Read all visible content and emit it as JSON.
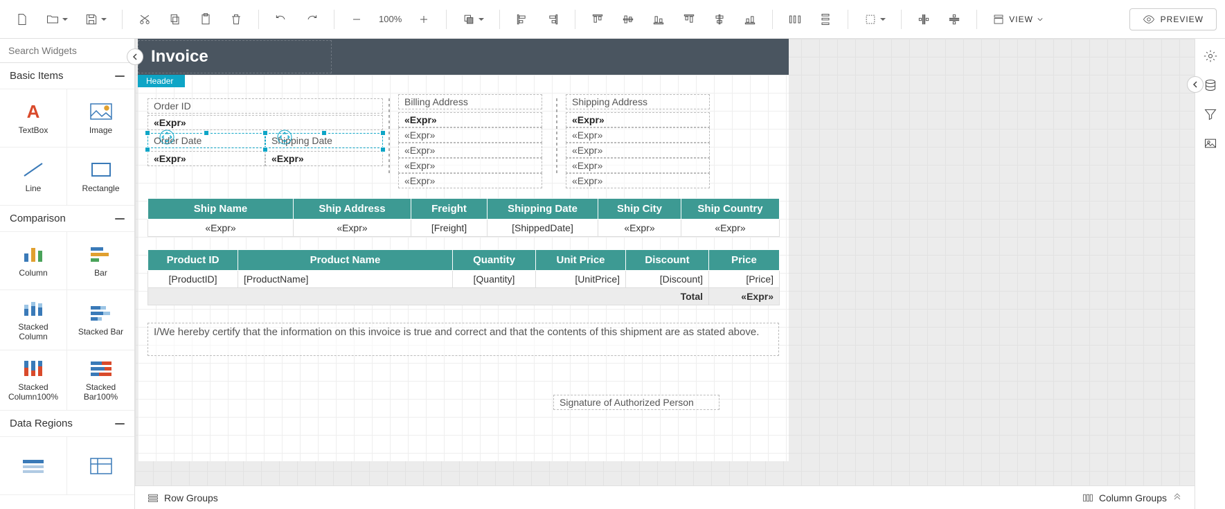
{
  "toolbar": {
    "zoom": "100%",
    "view_label": "VIEW",
    "preview_label": "PREVIEW"
  },
  "search": {
    "placeholder": "Search Widgets"
  },
  "sections": {
    "basic": {
      "title": "Basic Items",
      "items": [
        "TextBox",
        "Image",
        "Line",
        "Rectangle"
      ]
    },
    "comparison": {
      "title": "Comparison",
      "items": [
        "Column",
        "Bar",
        "Stacked Column",
        "Stacked Bar",
        "Stacked Column100%",
        "Stacked Bar100%"
      ]
    },
    "dataregions": {
      "title": "Data Regions"
    }
  },
  "report": {
    "title": "Invoice",
    "header_tag": "Header",
    "fields": {
      "order_id_lbl": "Order ID",
      "order_id_val": "«Expr»",
      "order_date_lbl": "Order Date",
      "order_date_val": "«Expr»",
      "ship_date_lbl": "Shipping Date",
      "ship_date_val": "«Expr»",
      "billing_lbl": "Billing Address",
      "billing_vals": [
        "«Expr»",
        "«Expr»",
        "«Expr»",
        "«Expr»",
        "«Expr»"
      ],
      "shipping_lbl": "Shipping Address",
      "shipping_vals": [
        "«Expr»",
        "«Expr»",
        "«Expr»",
        "«Expr»",
        "«Expr»"
      ]
    },
    "ship_table": {
      "headers": [
        "Ship Name",
        "Ship Address",
        "Freight",
        "Shipping Date",
        "Ship City",
        "Ship Country"
      ],
      "row": [
        "«Expr»",
        "«Expr»",
        "[Freight]",
        "[ShippedDate]",
        "«Expr»",
        "«Expr»"
      ]
    },
    "product_table": {
      "headers": [
        "Product ID",
        "Product Name",
        "Quantity",
        "Unit Price",
        "Discount",
        "Price"
      ],
      "row": [
        "[ProductID]",
        "[ProductName]",
        "[Quantity]",
        "[UnitPrice]",
        "[Discount]",
        "[Price]"
      ],
      "total_label": "Total",
      "total_value": "«Expr»"
    },
    "certify": "I/We hereby certify that the information on this invoice is true and correct and that the contents of this shipment are as stated above.",
    "signature": "Signature of Authorized Person"
  },
  "groups": {
    "row_label": "Row Groups",
    "col_label": "Column Groups"
  }
}
